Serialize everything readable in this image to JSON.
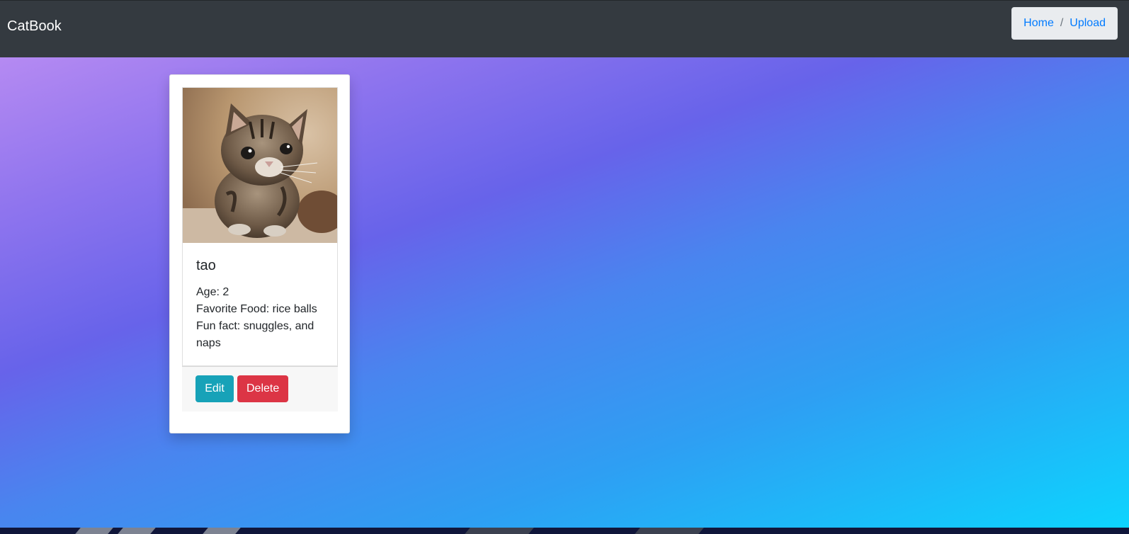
{
  "navbar": {
    "brand": "CatBook",
    "breadcrumb": [
      {
        "label": "Home"
      },
      {
        "label": "Upload"
      }
    ],
    "separator": "/"
  },
  "cat_card": {
    "name": "tao",
    "details": [
      "Age: 2",
      "Favorite Food: rice balls",
      "Fun fact: snuggles, and naps"
    ],
    "edit_label": "Edit",
    "delete_label": "Delete"
  },
  "colors": {
    "navbar_bg": "#343a40",
    "link": "#007bff",
    "edit_button": "#17a2b8",
    "delete_button": "#dc3545",
    "gradient": [
      "#b58af2",
      "#6763ea",
      "#2e9ff3",
      "#0dd4fe"
    ]
  }
}
